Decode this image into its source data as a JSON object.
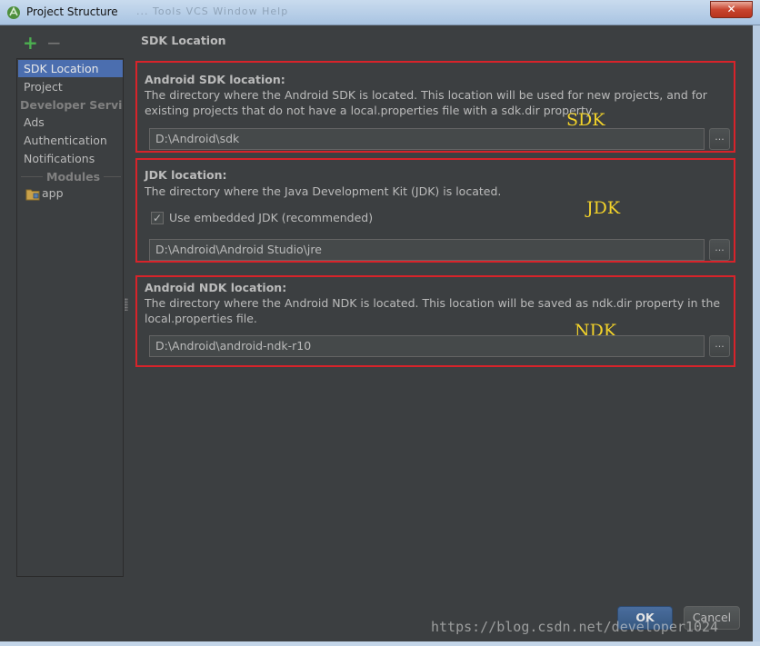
{
  "window": {
    "title": "Project Structure",
    "ghost_menu_text": "... Tools VCS Window Help",
    "close_label": "✕"
  },
  "sidebar": {
    "add_label": "+",
    "remove_label": "−",
    "items": [
      {
        "label": "SDK Location",
        "selected": true
      },
      {
        "label": "Project"
      },
      {
        "label": "Developer Servic...",
        "header": true
      },
      {
        "label": "Ads"
      },
      {
        "label": "Authentication"
      },
      {
        "label": "Notifications"
      }
    ],
    "modules_header": "Modules",
    "modules": [
      {
        "label": "app"
      }
    ]
  },
  "main": {
    "title": "SDK Location",
    "sdk": {
      "heading": "Android SDK location:",
      "description": "The directory where the Android SDK is located. This location will be used for new projects, and for existing projects that do not have a local.properties file with a sdk.dir property.",
      "path": "D:\\Android\\sdk",
      "annotation": "SDK"
    },
    "jdk": {
      "heading": "JDK location:",
      "description": "The directory where the Java Development Kit (JDK) is located.",
      "embedded_checkbox_label": "Use embedded JDK (recommended)",
      "embedded_checked": true,
      "path": "D:\\Android\\Android Studio\\jre",
      "annotation": "JDK"
    },
    "ndk": {
      "heading": "Android NDK location:",
      "description": "The directory where the Android NDK is located. This location will be saved as ndk.dir property in the local.properties file.",
      "path": "D:\\Android\\android-ndk-r10",
      "annotation": "NDK"
    },
    "browse_label": "...",
    "highlight_color": "#d8232a",
    "annotation_color": "#f2d22a"
  },
  "footer": {
    "ok_label": "OK",
    "cancel_label": "Cancel"
  },
  "watermark": "https://blog.csdn.net/developer1024"
}
